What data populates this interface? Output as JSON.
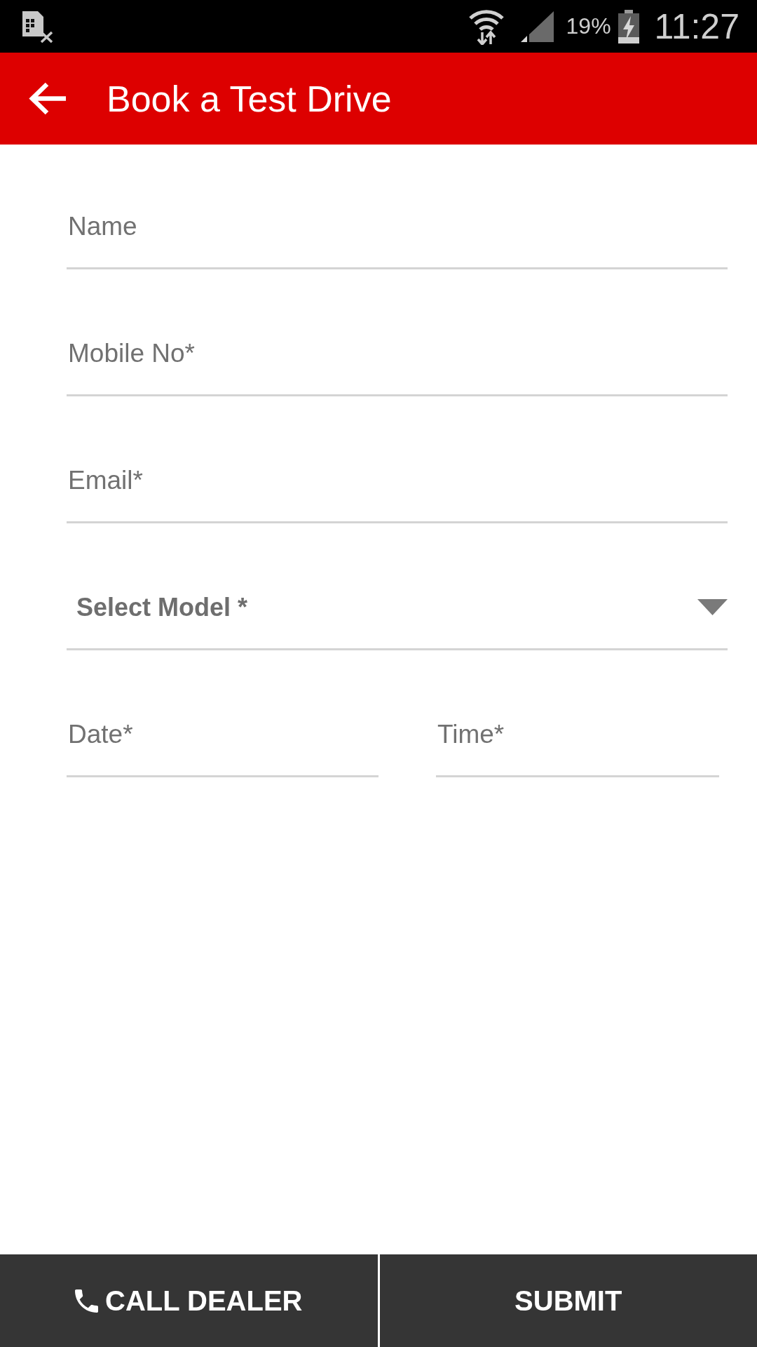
{
  "status_bar": {
    "battery_percent": "19%",
    "time": "11:27"
  },
  "app_bar": {
    "title": "Book a Test Drive"
  },
  "form": {
    "fields": [
      {
        "kind": "text",
        "placeholder": "Name"
      },
      {
        "kind": "text",
        "placeholder": "Mobile No*"
      },
      {
        "kind": "text",
        "placeholder": "Email*"
      },
      {
        "kind": "dropdown",
        "placeholder": "Select Model *"
      }
    ],
    "schedule": [
      {
        "placeholder": "Date*"
      },
      {
        "placeholder": "Time*"
      }
    ]
  },
  "bottom_bar": [
    {
      "kind": "call",
      "label": "CALL DEALER"
    },
    {
      "kind": "submit",
      "label": "SUBMIT"
    }
  ]
}
